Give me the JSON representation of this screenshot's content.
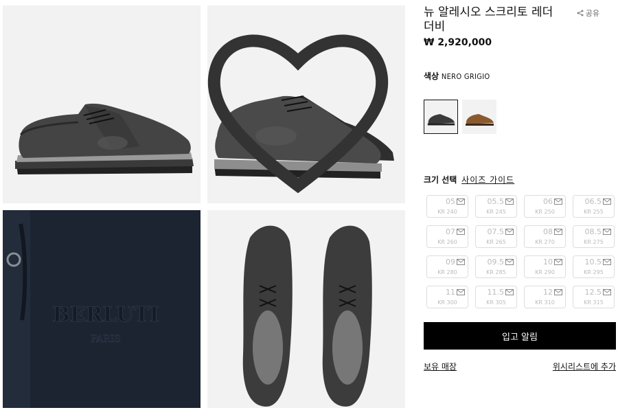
{
  "product": {
    "title": "뉴 알레시오 스크리토 레더 더비",
    "price": "₩ 2,920,000",
    "share_label": "공유"
  },
  "color": {
    "label": "색상",
    "value": "NERO GRIGIO"
  },
  "size": {
    "label": "크기 선택",
    "guide_link": "사이즈 가이드",
    "options": [
      {
        "eu": "05",
        "kr": "KR 240"
      },
      {
        "eu": "05.5",
        "kr": "KR 245"
      },
      {
        "eu": "06",
        "kr": "KR 250"
      },
      {
        "eu": "06.5",
        "kr": "KR 255"
      },
      {
        "eu": "07",
        "kr": "KR 260"
      },
      {
        "eu": "07.5",
        "kr": "KR 265"
      },
      {
        "eu": "08",
        "kr": "KR 270"
      },
      {
        "eu": "08.5",
        "kr": "KR 275"
      },
      {
        "eu": "09",
        "kr": "KR 280"
      },
      {
        "eu": "09.5",
        "kr": "KR 285"
      },
      {
        "eu": "10",
        "kr": "KR 290"
      },
      {
        "eu": "10.5",
        "kr": "KR 295"
      },
      {
        "eu": "11",
        "kr": "KR 300"
      },
      {
        "eu": "11.5",
        "kr": "KR 305"
      },
      {
        "eu": "12",
        "kr": "KR 310"
      },
      {
        "eu": "12.5",
        "kr": "KR 315"
      }
    ]
  },
  "actions": {
    "notify_button": "입고 알림",
    "store_link": "보유 매장",
    "wishlist_link": "위시리스트에 추가"
  },
  "gallery": {
    "leather_logo": "BERLUTI",
    "leather_sub": "PARIS"
  },
  "colors": {
    "accent": "#000000",
    "disabled": "#bbbbbb"
  }
}
